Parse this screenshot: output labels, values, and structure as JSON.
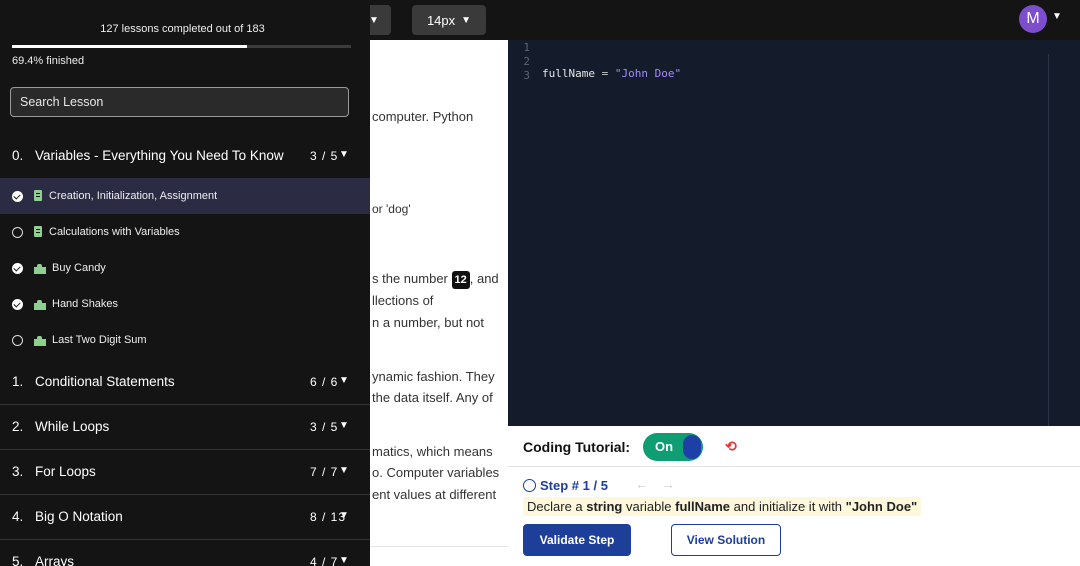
{
  "topbar": {
    "font_size": "14px",
    "avatar_initial": "M"
  },
  "sidebar": {
    "progress_text": "127 lessons completed out of 183",
    "progress_fraction": 0.694,
    "progress_pct": "69.4% finished",
    "search_placeholder": "Search Lesson",
    "section0": {
      "idx": "0.",
      "title": "Variables - Everything You Need To Know",
      "count": "3 / 5"
    },
    "lessons": [
      {
        "title": "Creation, Initialization, Assignment",
        "status": "done",
        "type": "book-icon",
        "active": true
      },
      {
        "title": "Calculations with Variables",
        "status": "todo",
        "type": "book-icon",
        "active": false
      },
      {
        "title": "Buy Candy",
        "status": "done",
        "type": "puzzle-icon",
        "active": false
      },
      {
        "title": "Hand Shakes",
        "status": "done",
        "type": "puzzle-icon",
        "active": false
      },
      {
        "title": "Last Two Digit Sum",
        "status": "todo",
        "type": "puzzle-icon",
        "active": false
      }
    ],
    "sections": [
      {
        "idx": "1.",
        "title": "Conditional Statements",
        "count": "6 / 6"
      },
      {
        "idx": "2.",
        "title": "While Loops",
        "count": "3 / 5"
      },
      {
        "idx": "3.",
        "title": "For Loops",
        "count": "7 / 7"
      },
      {
        "idx": "4.",
        "title": "Big O Notation",
        "count": "8 / 13"
      },
      {
        "idx": "5.",
        "title": "Arrays",
        "count": "4 / 7"
      }
    ]
  },
  "lesson_text": {
    "l1": "computer. Python",
    "l2": "or 'dog'",
    "l3a": "s the number ",
    "l3_badge": "12",
    "l3b": ", and",
    "l4": "llections of",
    "l5": "n a number, but not",
    "l6": "ynamic fashion. They",
    "l7": "the data itself. Any of",
    "l8": "matics, which means",
    "l9": "o. Computer variables",
    "l10": "ent values at different"
  },
  "editor": {
    "line_numbers": [
      "1",
      "2",
      "3"
    ],
    "var_name": "fullName",
    "operator": " = ",
    "string_value": "\"John Doe\""
  },
  "tutorial": {
    "label": "Coding Tutorial:",
    "toggle_label": "On",
    "refresh_icon": "⟲",
    "step_title": "Step # 1 / 5",
    "arrows": "←→",
    "instr_1": "Declare a ",
    "instr_2": "string",
    "instr_3": " variable ",
    "instr_4": "fullName",
    "instr_5": " and initialize it with ",
    "instr_6": "\"John Doe\"",
    "validate_label": "Validate Step",
    "solution_label": "View Solution"
  },
  "colors": {
    "accent_blue": "#1d3f9a",
    "toggle_green": "#0f9d74",
    "avatar_purple": "#7c4dcc",
    "active_row": "#2b2c44"
  }
}
